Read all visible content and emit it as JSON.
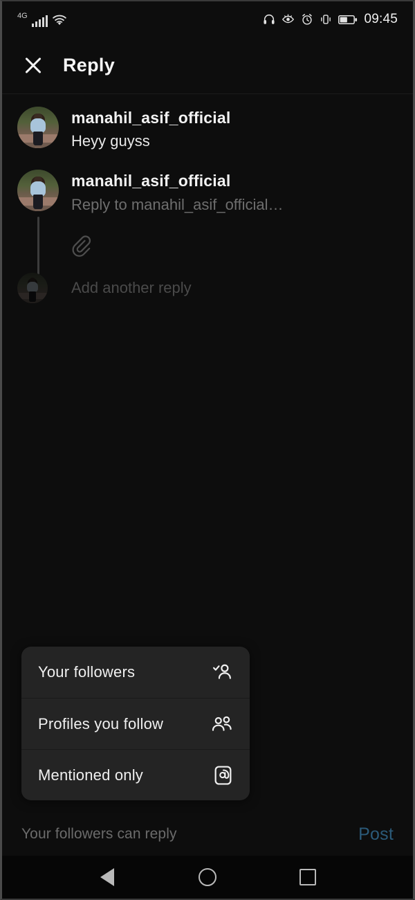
{
  "status_bar": {
    "network_label": "4G",
    "signal_icon": "signal-bars-icon",
    "wifi_icon": "wifi-icon",
    "headphones_icon": "headphones-icon",
    "eye_comfort_icon": "eye-comfort-icon",
    "alarm_icon": "alarm-clock-icon",
    "vibrate_icon": "vibrate-icon",
    "battery_icon": "battery-icon",
    "time": "09:45"
  },
  "header": {
    "close_icon": "close-icon",
    "title": "Reply"
  },
  "thread": {
    "original_post": {
      "avatar": "user-avatar",
      "username": "manahil_asif_official",
      "text": "Heyy guyss"
    },
    "reply_composer": {
      "avatar": "user-avatar",
      "username": "manahil_asif_official",
      "placeholder": "Reply to manahil_asif_official…",
      "value": ""
    },
    "attachment": {
      "icon": "paperclip-icon"
    },
    "add_another": {
      "avatar": "user-avatar-dim",
      "label": "Add another reply"
    }
  },
  "audience_menu": {
    "items": [
      {
        "label": "Your followers",
        "icon": "person-check-icon"
      },
      {
        "label": "Profiles you follow",
        "icon": "people-icon"
      },
      {
        "label": "Mentioned only",
        "icon": "at-mention-icon"
      }
    ]
  },
  "bottom_bar": {
    "audience_note": "Your followers can reply",
    "post_label": "Post"
  },
  "nav_bar": {
    "back_icon": "back-triangle-icon",
    "home_icon": "home-circle-icon",
    "recents_icon": "recents-square-icon"
  },
  "colors": {
    "background": "#0d0d0d",
    "menu_background": "#242424",
    "post_accent": "#2b5a79",
    "muted_text": "#6b6b6b"
  }
}
